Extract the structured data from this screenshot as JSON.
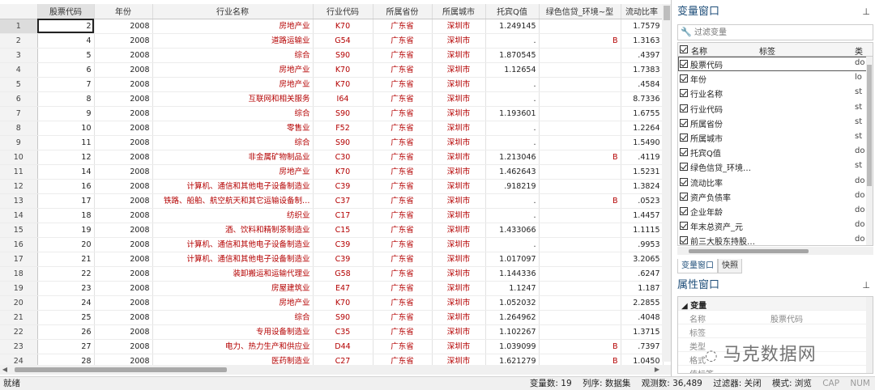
{
  "grid": {
    "columns": [
      {
        "key": "rownum",
        "label": ""
      },
      {
        "key": "code",
        "label": "股票代码"
      },
      {
        "key": "year",
        "label": "年份"
      },
      {
        "key": "industry",
        "label": "行业名称"
      },
      {
        "key": "indcode",
        "label": "行业代码"
      },
      {
        "key": "province",
        "label": "所属省份"
      },
      {
        "key": "city",
        "label": "所属城市"
      },
      {
        "key": "tobinq",
        "label": "托宾Q值"
      },
      {
        "key": "green",
        "label": "绿色信贷_环境~型"
      },
      {
        "key": "ratio",
        "label": "流动比率"
      }
    ],
    "rows": [
      {
        "n": "1",
        "code": "2",
        "year": "2008",
        "industry": "房地产业",
        "indcode": "K70",
        "province": "广东省",
        "city": "深圳市",
        "tobinq": "1.249145",
        "green": "",
        "ratio": "1.7579"
      },
      {
        "n": "2",
        "code": "4",
        "year": "2008",
        "industry": "道路运输业",
        "indcode": "G54",
        "province": "广东省",
        "city": "深圳市",
        "tobinq": ".",
        "green": "B",
        "ratio": "1.3163"
      },
      {
        "n": "3",
        "code": "5",
        "year": "2008",
        "industry": "综合",
        "indcode": "S90",
        "province": "广东省",
        "city": "深圳市",
        "tobinq": "1.870545",
        "green": "",
        "ratio": ".4397"
      },
      {
        "n": "4",
        "code": "6",
        "year": "2008",
        "industry": "房地产业",
        "indcode": "K70",
        "province": "广东省",
        "city": "深圳市",
        "tobinq": "1.12654",
        "green": "",
        "ratio": "1.7383"
      },
      {
        "n": "5",
        "code": "7",
        "year": "2008",
        "industry": "房地产业",
        "indcode": "K70",
        "province": "广东省",
        "city": "深圳市",
        "tobinq": ".",
        "green": "",
        "ratio": ".4584"
      },
      {
        "n": "6",
        "code": "8",
        "year": "2008",
        "industry": "互联网和相关服务",
        "indcode": "I64",
        "province": "广东省",
        "city": "深圳市",
        "tobinq": ".",
        "green": "",
        "ratio": "8.7336"
      },
      {
        "n": "7",
        "code": "9",
        "year": "2008",
        "industry": "综合",
        "indcode": "S90",
        "province": "广东省",
        "city": "深圳市",
        "tobinq": "1.193601",
        "green": "",
        "ratio": "1.6755"
      },
      {
        "n": "8",
        "code": "10",
        "year": "2008",
        "industry": "零售业",
        "indcode": "F52",
        "province": "广东省",
        "city": "深圳市",
        "tobinq": ".",
        "green": "",
        "ratio": "1.2264"
      },
      {
        "n": "9",
        "code": "11",
        "year": "2008",
        "industry": "综合",
        "indcode": "S90",
        "province": "广东省",
        "city": "深圳市",
        "tobinq": ".",
        "green": "",
        "ratio": "1.5490"
      },
      {
        "n": "10",
        "code": "12",
        "year": "2008",
        "industry": "非金属矿物制品业",
        "indcode": "C30",
        "province": "广东省",
        "city": "深圳市",
        "tobinq": "1.213046",
        "green": "B",
        "ratio": ".4119"
      },
      {
        "n": "11",
        "code": "14",
        "year": "2008",
        "industry": "房地产业",
        "indcode": "K70",
        "province": "广东省",
        "city": "深圳市",
        "tobinq": "1.462643",
        "green": "",
        "ratio": "1.5231"
      },
      {
        "n": "12",
        "code": "16",
        "year": "2008",
        "industry": "计算机、通信和其他电子设备制造业",
        "indcode": "C39",
        "province": "广东省",
        "city": "深圳市",
        "tobinq": ".918219",
        "green": "",
        "ratio": "1.3824"
      },
      {
        "n": "13",
        "code": "17",
        "year": "2008",
        "industry": "铁路、船舶、航空航天和其它运输设备制…",
        "indcode": "C37",
        "province": "广东省",
        "city": "深圳市",
        "tobinq": ".",
        "green": "B",
        "ratio": ".0523"
      },
      {
        "n": "14",
        "code": "18",
        "year": "2008",
        "industry": "纺织业",
        "indcode": "C17",
        "province": "广东省",
        "city": "深圳市",
        "tobinq": ".",
        "green": "",
        "ratio": "1.4457"
      },
      {
        "n": "15",
        "code": "19",
        "year": "2008",
        "industry": "酒、饮料和精制茶制造业",
        "indcode": "C15",
        "province": "广东省",
        "city": "深圳市",
        "tobinq": "1.433066",
        "green": "",
        "ratio": "1.1115"
      },
      {
        "n": "16",
        "code": "20",
        "year": "2008",
        "industry": "计算机、通信和其他电子设备制造业",
        "indcode": "C39",
        "province": "广东省",
        "city": "深圳市",
        "tobinq": ".",
        "green": "",
        "ratio": ".9953"
      },
      {
        "n": "17",
        "code": "21",
        "year": "2008",
        "industry": "计算机、通信和其他电子设备制造业",
        "indcode": "C39",
        "province": "广东省",
        "city": "深圳市",
        "tobinq": "1.017097",
        "green": "",
        "ratio": "3.2065"
      },
      {
        "n": "18",
        "code": "22",
        "year": "2008",
        "industry": "装卸搬运和运输代理业",
        "indcode": "G58",
        "province": "广东省",
        "city": "深圳市",
        "tobinq": "1.144336",
        "green": "",
        "ratio": ".6247"
      },
      {
        "n": "19",
        "code": "23",
        "year": "2008",
        "industry": "房屋建筑业",
        "indcode": "E47",
        "province": "广东省",
        "city": "深圳市",
        "tobinq": "1.1247",
        "green": "",
        "ratio": "1.187"
      },
      {
        "n": "20",
        "code": "24",
        "year": "2008",
        "industry": "房地产业",
        "indcode": "K70",
        "province": "广东省",
        "city": "深圳市",
        "tobinq": "1.052032",
        "green": "",
        "ratio": "2.2855"
      },
      {
        "n": "21",
        "code": "25",
        "year": "2008",
        "industry": "综合",
        "indcode": "S90",
        "province": "广东省",
        "city": "深圳市",
        "tobinq": "1.264962",
        "green": "",
        "ratio": ".4048"
      },
      {
        "n": "22",
        "code": "26",
        "year": "2008",
        "industry": "专用设备制造业",
        "indcode": "C35",
        "province": "广东省",
        "city": "深圳市",
        "tobinq": "1.102267",
        "green": "",
        "ratio": "1.3715"
      },
      {
        "n": "23",
        "code": "27",
        "year": "2008",
        "industry": "电力、热力生产和供应业",
        "indcode": "D44",
        "province": "广东省",
        "city": "深圳市",
        "tobinq": "1.039099",
        "green": "B",
        "ratio": ".7397"
      },
      {
        "n": "24",
        "code": "28",
        "year": "2008",
        "industry": "医药制造业",
        "indcode": "C27",
        "province": "广东省",
        "city": "深圳市",
        "tobinq": "1.621279",
        "green": "B",
        "ratio": "1.0450"
      }
    ]
  },
  "varwin": {
    "title": "变量窗口",
    "filter_placeholder": "过滤变量",
    "header_name": "名称",
    "header_label": "标签",
    "header_type": "类",
    "vars": [
      {
        "name": "股票代码",
        "type": "do"
      },
      {
        "name": "年份",
        "type": "lo"
      },
      {
        "name": "行业名称",
        "type": "st"
      },
      {
        "name": "行业代码",
        "type": "st"
      },
      {
        "name": "所属省份",
        "type": "st"
      },
      {
        "name": "所属城市",
        "type": "st"
      },
      {
        "name": "托宾Q值",
        "type": "do"
      },
      {
        "name": "绿色信贷_环境…",
        "type": "st"
      },
      {
        "name": "流动比率",
        "type": "do"
      },
      {
        "name": "资产负债率",
        "type": "do"
      },
      {
        "name": "企业年龄",
        "type": "do"
      },
      {
        "name": "年末总资产_元",
        "type": "do"
      },
      {
        "name": "前三大股东持股…",
        "type": "do"
      }
    ]
  },
  "tabs": {
    "variables": "变量窗口",
    "snapshots": "快照"
  },
  "propwin": {
    "title": "属性窗口",
    "group": "变量",
    "rows": [
      {
        "k": "名称",
        "v": "股票代码"
      },
      {
        "k": "标签",
        "v": ""
      },
      {
        "k": "类型",
        "v": ""
      },
      {
        "k": "格式",
        "v": ""
      },
      {
        "k": "值标签",
        "v": ""
      }
    ]
  },
  "watermark": "马克数据网",
  "status": {
    "left": "就绪",
    "varcount": "变量数: 19",
    "sort": "列序: 数据集",
    "obs": "观测数: 36,489",
    "filter": "过滤器: 关闭",
    "mode": "模式: 浏览",
    "cap": "CAP",
    "num": "NUM"
  },
  "colors": {
    "string_text": "#b40000",
    "pane_title": "#1e4e79"
  }
}
